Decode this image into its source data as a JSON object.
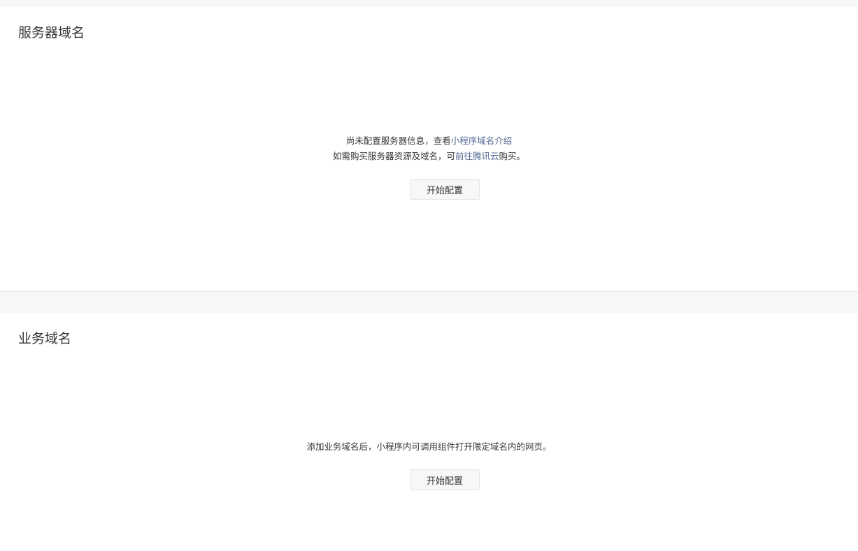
{
  "server_domain": {
    "title": "服务器域名",
    "line1_prefix": "尚未配置服务器信息，查看",
    "line1_link": "小程序域名介绍",
    "line2_prefix": "如需购买服务器资源及域名，可",
    "line2_link": "前往腾讯云",
    "line2_suffix": "购买。",
    "button_label": "开始配置"
  },
  "business_domain": {
    "title": "业务域名",
    "description": "添加业务域名后，小程序内可调用组件打开限定域名内的网页。",
    "button_label": "开始配置"
  },
  "colors": {
    "background": "#f6f8f9",
    "panel": "#ffffff",
    "text": "#353535",
    "link": "#576b95"
  }
}
